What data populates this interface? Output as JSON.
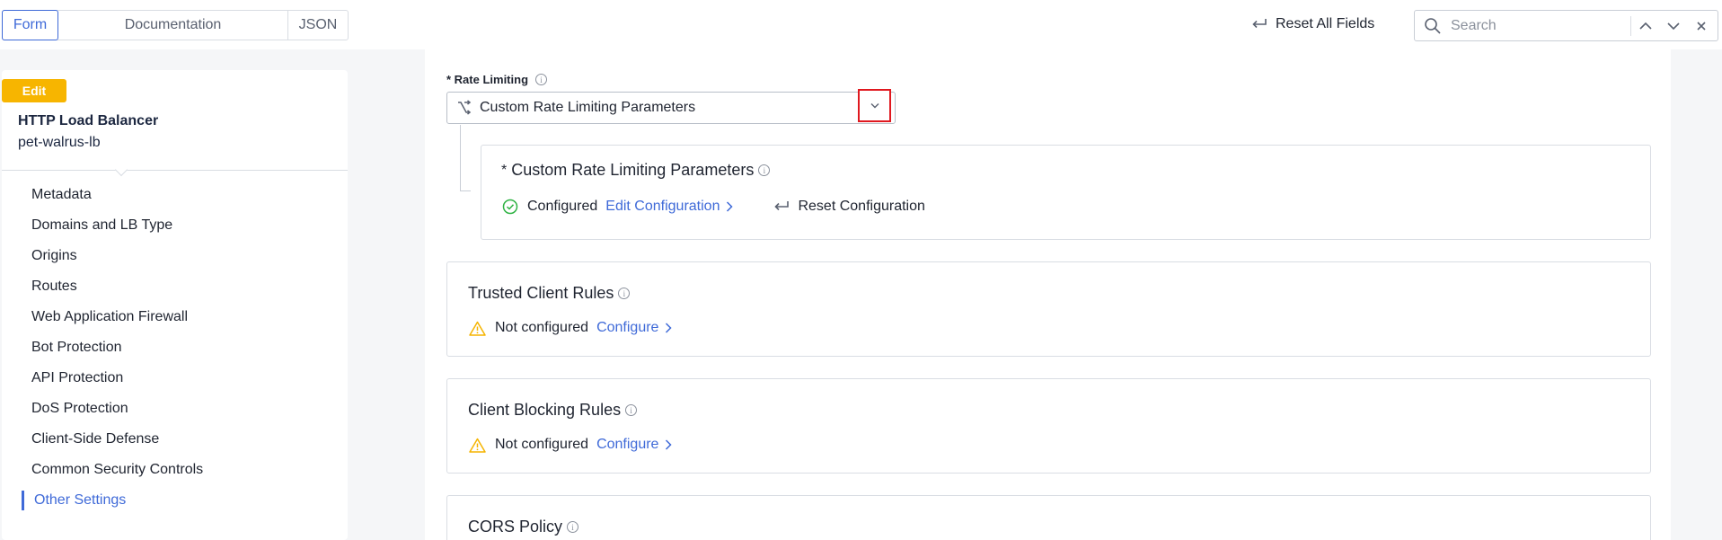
{
  "tabs": [
    {
      "label": "Form",
      "active": true
    },
    {
      "label": "Documentation",
      "active": false
    },
    {
      "label": "JSON",
      "active": false
    }
  ],
  "header": {
    "reset_all_label": "Reset All Fields",
    "search_placeholder": "Search"
  },
  "sidebar": {
    "badge": "Edit",
    "object_type": "HTTP Load Balancer",
    "object_name": "pet-walrus-lb",
    "items": [
      {
        "label": "Metadata"
      },
      {
        "label": "Domains and LB Type"
      },
      {
        "label": "Origins"
      },
      {
        "label": "Routes"
      },
      {
        "label": "Web Application Firewall"
      },
      {
        "label": "Bot Protection"
      },
      {
        "label": "API Protection"
      },
      {
        "label": "DoS Protection"
      },
      {
        "label": "Client-Side Defense"
      },
      {
        "label": "Common Security Controls"
      },
      {
        "label": "Other Settings",
        "active": true
      }
    ]
  },
  "main": {
    "rate_limiting": {
      "label": "* Rate Limiting",
      "selected_value": "Custom Rate Limiting Parameters"
    },
    "custom_params_card": {
      "required_marker": "*",
      "title": "Custom Rate Limiting Parameters",
      "status": "Configured",
      "edit_link": "Edit Configuration",
      "reset_label": "Reset Configuration"
    },
    "sections": [
      {
        "title": "Trusted Client Rules",
        "status": "Not configured",
        "action": "Configure"
      },
      {
        "title": "Client Blocking Rules",
        "status": "Not configured",
        "action": "Configure"
      },
      {
        "title": "CORS Policy"
      }
    ]
  },
  "colors": {
    "accent": "#3f6ad8",
    "badge": "#f7b500",
    "highlight": "#e0181f",
    "success": "#2fb344",
    "warning": "#f5b400"
  },
  "icons": {
    "info": "info-icon",
    "reset": "undo-arrow-icon",
    "search": "search-icon",
    "select_option": "branch-icon",
    "dropdown": "chevron-down-icon",
    "configured": "check-circle-icon",
    "not_configured": "warning-triangle-icon"
  }
}
